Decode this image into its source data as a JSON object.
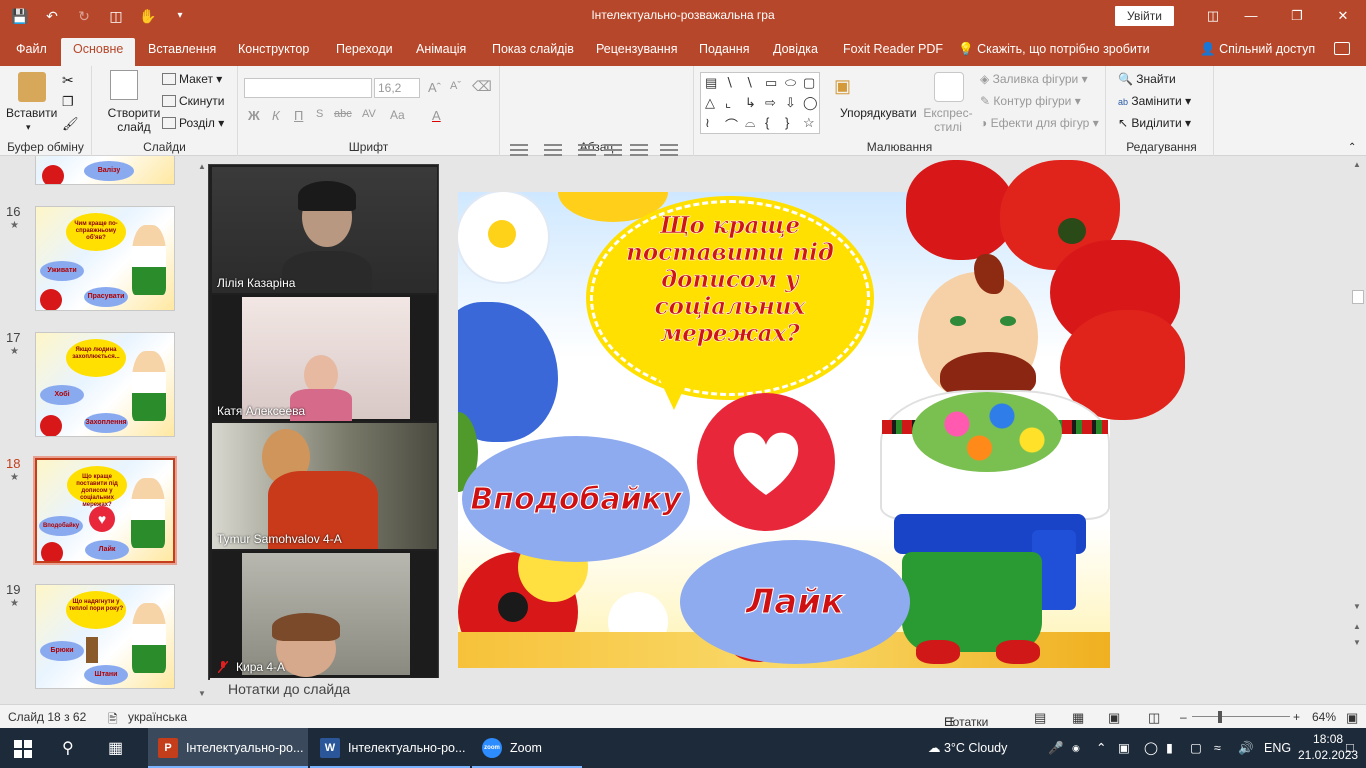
{
  "window": {
    "title": "Інтелектуально-розважальна гра",
    "signin_label": "Увійти"
  },
  "tabs": [
    {
      "label": "Файл"
    },
    {
      "label": "Основне"
    },
    {
      "label": "Вставлення"
    },
    {
      "label": "Конструктор"
    },
    {
      "label": "Переходи"
    },
    {
      "label": "Анімація"
    },
    {
      "label": "Показ слайдів"
    },
    {
      "label": "Рецензування"
    },
    {
      "label": "Подання"
    },
    {
      "label": "Довідка"
    },
    {
      "label": "Foxit Reader PDF"
    }
  ],
  "tell_me": "Скажіть, що потрібно зробити",
  "share": "Спільний доступ",
  "ribbon": {
    "clipboard": {
      "paste": "Вставити",
      "label": "Буфер обміну"
    },
    "slides": {
      "new_slide": "Створити слайд",
      "layout": "Макет",
      "reset": "Скинути",
      "section": "Розділ",
      "label": "Слайди"
    },
    "font": {
      "size": "16,2",
      "label": "Шрифт",
      "bold": "Ж",
      "italic": "К",
      "underline": "П",
      "strike": "abc",
      "spacing": "AV",
      "case": "Aa"
    },
    "paragraph": {
      "label": "Абзац"
    },
    "drawing": {
      "arrange": "Упорядкувати",
      "quick_styles": "Експрес-стилі",
      "fill": "Заливка фігури",
      "outline": "Контур фігури",
      "effects": "Ефекти для фігур",
      "label": "Малювання"
    },
    "editing": {
      "find": "Знайти",
      "replace": "Замінити",
      "select": "Виділити",
      "label": "Редагування"
    }
  },
  "thumbnails": [
    {
      "num": "16",
      "bubble": "Чим краще по-справжньому об'яв?",
      "left": "Уживати",
      "right": "Прасувати"
    },
    {
      "num": "17",
      "bubble": "Якщо людина захоплюється...",
      "left": "Хобі",
      "right": "Захоплення"
    },
    {
      "num": "18",
      "bubble": "Що краще поставити під дописом у соціальних мережах?",
      "left": "Вподобайку",
      "right": "Лайк"
    },
    {
      "num": "19",
      "bubble": "Що надягнути у теплої пори року?",
      "left": "Брюки",
      "right": "Штани"
    }
  ],
  "thumb_top_label": "Валізу",
  "zoom": {
    "participants": [
      {
        "name": "Лілія Казаріна"
      },
      {
        "name": "Катя Алексеева"
      },
      {
        "name": "Tymur Samohvalov 4-A"
      },
      {
        "name": "Кира 4-А"
      }
    ]
  },
  "slide": {
    "question_lines": [
      "Що краще",
      "поставити під",
      "дописом  у",
      "соціальних",
      "мережах?"
    ],
    "option_left": "Вподобайку",
    "option_right": "Лайк",
    "heart_icon": "heart-icon"
  },
  "notes_label": "Нотатки до слайда",
  "status": {
    "slide_count": "Слайд 18 з 62",
    "language": "українська",
    "notes": "Нотатки",
    "zoom": "64%"
  },
  "taskbar": {
    "apps": [
      {
        "label": "Інтелектуально-ро..."
      },
      {
        "label": "Інтелектуально-ро..."
      },
      {
        "label": "Zoom"
      }
    ],
    "weather": "3°C  Cloudy",
    "lang": "ENG",
    "time": "18:08",
    "date": "21.02.2023"
  },
  "colors": {
    "accent": "#b7472a",
    "active_slide": "#c43e1c",
    "question_text": "#d01414",
    "bubble": "#ffe000",
    "oval": "#8fabef",
    "heart_circle": "#e8283a"
  }
}
